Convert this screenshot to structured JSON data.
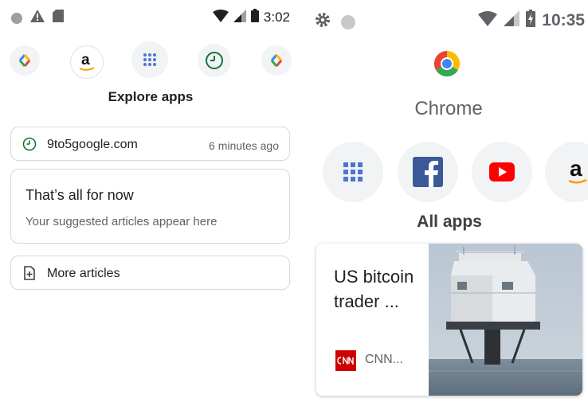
{
  "left": {
    "status": {
      "time": "3:02"
    },
    "explore_label": "Explore apps",
    "recent": {
      "domain": "9to5google.com",
      "time": "6 minutes ago"
    },
    "empty_card": {
      "title": "That’s all for now",
      "subtitle": "Your suggested articles appear here"
    },
    "more_articles_label": "More articles"
  },
  "right": {
    "status": {
      "time": "10:35"
    },
    "app_title": "Chrome",
    "all_apps_label": "All apps",
    "article": {
      "headline": "US bitcoin trader ...",
      "source": "CNN..."
    }
  },
  "colors": {
    "accent_green": "#137333",
    "card_border": "#d6d8db",
    "chip_bg": "#f1f3f4"
  }
}
